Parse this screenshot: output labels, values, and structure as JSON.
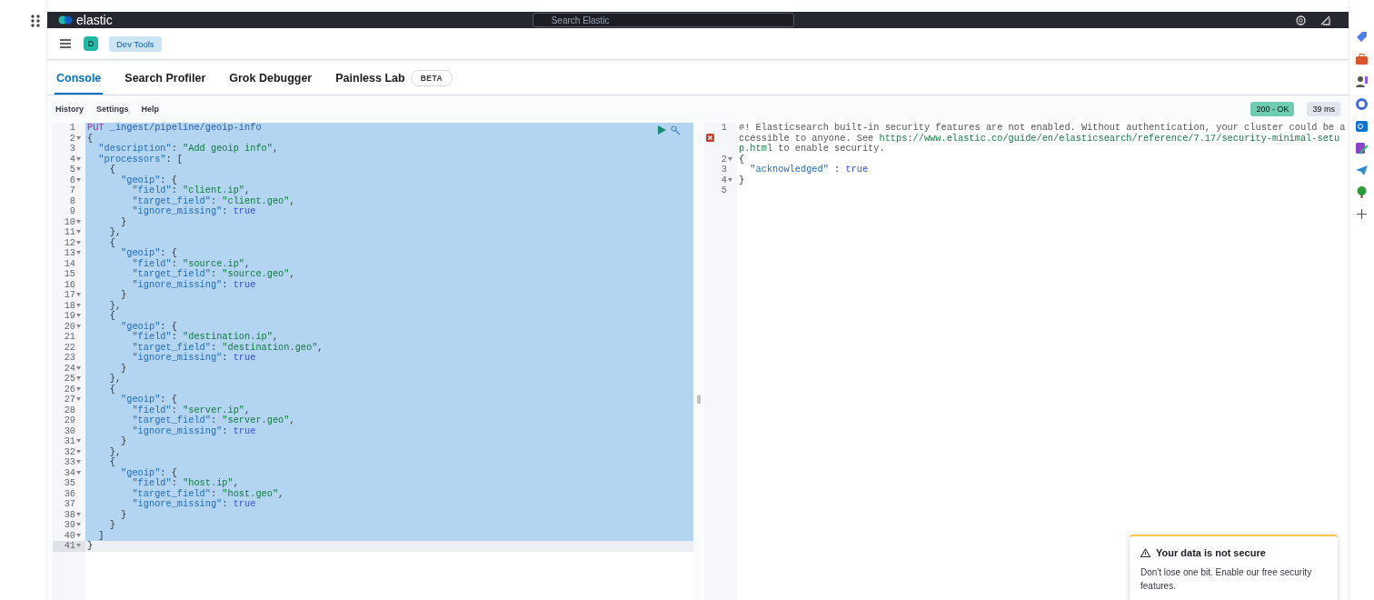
{
  "top_bar": {
    "logo": "elastic",
    "search": {
      "placeholder": "Search Elastic"
    }
  },
  "header": {
    "avatar": "D",
    "breadcrumb": "Dev Tools"
  },
  "tabs": [
    {
      "label": "Console",
      "selected": true
    },
    {
      "label": "Search Profiler",
      "selected": false
    },
    {
      "label": "Grok Debugger",
      "selected": false
    },
    {
      "label": "Painless Lab",
      "selected": false,
      "badge": "BETA"
    }
  ],
  "toolbar": {
    "items": [
      "History",
      "Settings",
      "Help"
    ],
    "status": "200 - OK",
    "time": "39 ms"
  },
  "request": {
    "lines": [
      {
        "n": "1",
        "fold": false,
        "selected": true,
        "tokens": [
          {
            "kind": "method",
            "text": "PUT "
          },
          {
            "kind": "url",
            "text": "_ingest/pipeline/geoip-info"
          }
        ]
      },
      {
        "n": "2",
        "fold": true,
        "selected": true,
        "tokens": [
          {
            "kind": "punct",
            "text": "{"
          }
        ]
      },
      {
        "n": "3",
        "fold": false,
        "selected": true,
        "tokens": [
          {
            "kind": "key",
            "text": "  \"description\""
          },
          {
            "kind": "punct",
            "text": ": "
          },
          {
            "kind": "str",
            "text": "\"Add geoip info\""
          },
          {
            "kind": "punct",
            "text": ","
          }
        ]
      },
      {
        "n": "4",
        "fold": true,
        "selected": true,
        "tokens": [
          {
            "kind": "key",
            "text": "  \"processors\""
          },
          {
            "kind": "punct",
            "text": ": ["
          }
        ]
      },
      {
        "n": "5",
        "fold": true,
        "selected": true,
        "tokens": [
          {
            "kind": "punct",
            "text": "    {"
          }
        ]
      },
      {
        "n": "6",
        "fold": true,
        "selected": true,
        "tokens": [
          {
            "kind": "key",
            "text": "      \"geoip\""
          },
          {
            "kind": "punct",
            "text": ": {"
          }
        ]
      },
      {
        "n": "7",
        "fold": false,
        "selected": true,
        "tokens": [
          {
            "kind": "key",
            "text": "        \"field\""
          },
          {
            "kind": "punct",
            "text": ": "
          },
          {
            "kind": "str",
            "text": "\"client.ip\""
          },
          {
            "kind": "punct",
            "text": ","
          }
        ]
      },
      {
        "n": "8",
        "fold": false,
        "selected": true,
        "tokens": [
          {
            "kind": "key",
            "text": "        \"target_field\""
          },
          {
            "kind": "punct",
            "text": ": "
          },
          {
            "kind": "str",
            "text": "\"client.geo\""
          },
          {
            "kind": "punct",
            "text": ","
          }
        ]
      },
      {
        "n": "9",
        "fold": false,
        "selected": true,
        "tokens": [
          {
            "kind": "key",
            "text": "        \"ignore_missing\""
          },
          {
            "kind": "punct",
            "text": ": "
          },
          {
            "kind": "bool",
            "text": "true"
          }
        ]
      },
      {
        "n": "10",
        "fold": true,
        "selected": true,
        "tokens": [
          {
            "kind": "punct",
            "text": "      }"
          }
        ]
      },
      {
        "n": "11",
        "fold": true,
        "selected": true,
        "tokens": [
          {
            "kind": "punct",
            "text": "    },"
          }
        ]
      },
      {
        "n": "12",
        "fold": true,
        "selected": true,
        "tokens": [
          {
            "kind": "punct",
            "text": "    {"
          }
        ]
      },
      {
        "n": "13",
        "fold": true,
        "selected": true,
        "tokens": [
          {
            "kind": "key",
            "text": "      \"geoip\""
          },
          {
            "kind": "punct",
            "text": ": {"
          }
        ]
      },
      {
        "n": "14",
        "fold": false,
        "selected": true,
        "tokens": [
          {
            "kind": "key",
            "text": "        \"field\""
          },
          {
            "kind": "punct",
            "text": ": "
          },
          {
            "kind": "str",
            "text": "\"source.ip\""
          },
          {
            "kind": "punct",
            "text": ","
          }
        ]
      },
      {
        "n": "15",
        "fold": false,
        "selected": true,
        "tokens": [
          {
            "kind": "key",
            "text": "        \"target_field\""
          },
          {
            "kind": "punct",
            "text": ": "
          },
          {
            "kind": "str",
            "text": "\"source.geo\""
          },
          {
            "kind": "punct",
            "text": ","
          }
        ]
      },
      {
        "n": "16",
        "fold": false,
        "selected": true,
        "tokens": [
          {
            "kind": "key",
            "text": "        \"ignore_missing\""
          },
          {
            "kind": "punct",
            "text": ": "
          },
          {
            "kind": "bool",
            "text": "true"
          }
        ]
      },
      {
        "n": "17",
        "fold": true,
        "selected": true,
        "tokens": [
          {
            "kind": "punct",
            "text": "      }"
          }
        ]
      },
      {
        "n": "18",
        "fold": true,
        "selected": true,
        "tokens": [
          {
            "kind": "punct",
            "text": "    },"
          }
        ]
      },
      {
        "n": "19",
        "fold": true,
        "selected": true,
        "tokens": [
          {
            "kind": "punct",
            "text": "    {"
          }
        ]
      },
      {
        "n": "20",
        "fold": true,
        "selected": true,
        "tokens": [
          {
            "kind": "key",
            "text": "      \"geoip\""
          },
          {
            "kind": "punct",
            "text": ": {"
          }
        ]
      },
      {
        "n": "21",
        "fold": false,
        "selected": true,
        "tokens": [
          {
            "kind": "key",
            "text": "        \"field\""
          },
          {
            "kind": "punct",
            "text": ": "
          },
          {
            "kind": "str",
            "text": "\"destination.ip\""
          },
          {
            "kind": "punct",
            "text": ","
          }
        ]
      },
      {
        "n": "22",
        "fold": false,
        "selected": true,
        "tokens": [
          {
            "kind": "key",
            "text": "        \"target_field\""
          },
          {
            "kind": "punct",
            "text": ": "
          },
          {
            "kind": "str",
            "text": "\"destination.geo\""
          },
          {
            "kind": "punct",
            "text": ","
          }
        ]
      },
      {
        "n": "23",
        "fold": false,
        "selected": true,
        "tokens": [
          {
            "kind": "key",
            "text": "        \"ignore_missing\""
          },
          {
            "kind": "punct",
            "text": ": "
          },
          {
            "kind": "bool",
            "text": "true"
          }
        ]
      },
      {
        "n": "24",
        "fold": true,
        "selected": true,
        "tokens": [
          {
            "kind": "punct",
            "text": "      }"
          }
        ]
      },
      {
        "n": "25",
        "fold": true,
        "selected": true,
        "tokens": [
          {
            "kind": "punct",
            "text": "    },"
          }
        ]
      },
      {
        "n": "26",
        "fold": true,
        "selected": true,
        "tokens": [
          {
            "kind": "punct",
            "text": "    {"
          }
        ]
      },
      {
        "n": "27",
        "fold": true,
        "selected": true,
        "tokens": [
          {
            "kind": "key",
            "text": "      \"geoip\""
          },
          {
            "kind": "punct",
            "text": ": {"
          }
        ]
      },
      {
        "n": "28",
        "fold": false,
        "selected": true,
        "tokens": [
          {
            "kind": "key",
            "text": "        \"field\""
          },
          {
            "kind": "punct",
            "text": ": "
          },
          {
            "kind": "str",
            "text": "\"server.ip\""
          },
          {
            "kind": "punct",
            "text": ","
          }
        ]
      },
      {
        "n": "29",
        "fold": false,
        "selected": true,
        "tokens": [
          {
            "kind": "key",
            "text": "        \"target_field\""
          },
          {
            "kind": "punct",
            "text": ": "
          },
          {
            "kind": "str",
            "text": "\"server.geo\""
          },
          {
            "kind": "punct",
            "text": ","
          }
        ]
      },
      {
        "n": "30",
        "fold": false,
        "selected": true,
        "tokens": [
          {
            "kind": "key",
            "text": "        \"ignore_missing\""
          },
          {
            "kind": "punct",
            "text": ": "
          },
          {
            "kind": "bool",
            "text": "true"
          }
        ]
      },
      {
        "n": "31",
        "fold": true,
        "selected": true,
        "tokens": [
          {
            "kind": "punct",
            "text": "      }"
          }
        ]
      },
      {
        "n": "32",
        "fold": true,
        "selected": true,
        "tokens": [
          {
            "kind": "punct",
            "text": "    },"
          }
        ]
      },
      {
        "n": "33",
        "fold": true,
        "selected": true,
        "tokens": [
          {
            "kind": "punct",
            "text": "    {"
          }
        ]
      },
      {
        "n": "34",
        "fold": true,
        "selected": true,
        "tokens": [
          {
            "kind": "key",
            "text": "      \"geoip\""
          },
          {
            "kind": "punct",
            "text": ": {"
          }
        ]
      },
      {
        "n": "35",
        "fold": false,
        "selected": true,
        "tokens": [
          {
            "kind": "key",
            "text": "        \"field\""
          },
          {
            "kind": "punct",
            "text": ": "
          },
          {
            "kind": "str",
            "text": "\"host.ip\""
          },
          {
            "kind": "punct",
            "text": ","
          }
        ]
      },
      {
        "n": "36",
        "fold": false,
        "selected": true,
        "tokens": [
          {
            "kind": "key",
            "text": "        \"target_field\""
          },
          {
            "kind": "punct",
            "text": ": "
          },
          {
            "kind": "str",
            "text": "\"host.geo\""
          },
          {
            "kind": "punct",
            "text": ","
          }
        ]
      },
      {
        "n": "37",
        "fold": false,
        "selected": true,
        "tokens": [
          {
            "kind": "key",
            "text": "        \"ignore_missing\""
          },
          {
            "kind": "punct",
            "text": ": "
          },
          {
            "kind": "bool",
            "text": "true"
          }
        ]
      },
      {
        "n": "38",
        "fold": true,
        "selected": true,
        "tokens": [
          {
            "kind": "punct",
            "text": "      }"
          }
        ]
      },
      {
        "n": "39",
        "fold": true,
        "selected": true,
        "tokens": [
          {
            "kind": "punct",
            "text": "    }"
          }
        ]
      },
      {
        "n": "40",
        "fold": true,
        "selected": true,
        "tokens": [
          {
            "kind": "punct",
            "text": "  ]"
          }
        ]
      },
      {
        "n": "41",
        "fold": true,
        "selected": false,
        "tokens": [
          {
            "kind": "punct",
            "text": "}"
          }
        ]
      }
    ]
  },
  "response": {
    "lines": [
      {
        "n": "1",
        "fold": false,
        "error": true,
        "tokens": [
          {
            "kind": "comment",
            "text": "#! Elasticsearch built-in security features are not enabled. Without authentication, your cluster could be accessible to anyone. See "
          },
          {
            "kind": "link",
            "text": "https://www.elastic.co/guide/en/elasticsearch/reference/7.17/security-minimal-setup.html"
          },
          {
            "kind": "comment",
            "text": " to enable security."
          }
        ]
      },
      {
        "n": "2",
        "fold": true,
        "error": false,
        "tokens": [
          {
            "kind": "punct",
            "text": "{"
          }
        ]
      },
      {
        "n": "3",
        "fold": false,
        "error": false,
        "tokens": [
          {
            "kind": "key",
            "text": "  \"acknowledged\""
          },
          {
            "kind": "punct",
            "text": " : "
          },
          {
            "kind": "bool",
            "text": "true"
          }
        ]
      },
      {
        "n": "4",
        "fold": true,
        "error": false,
        "tokens": [
          {
            "kind": "punct",
            "text": "}"
          }
        ]
      },
      {
        "n": "5",
        "fold": false,
        "error": false
      }
    ]
  },
  "toast": {
    "title": "Your data is not secure",
    "body": "Don't lose one bit. Enable our free security features."
  }
}
